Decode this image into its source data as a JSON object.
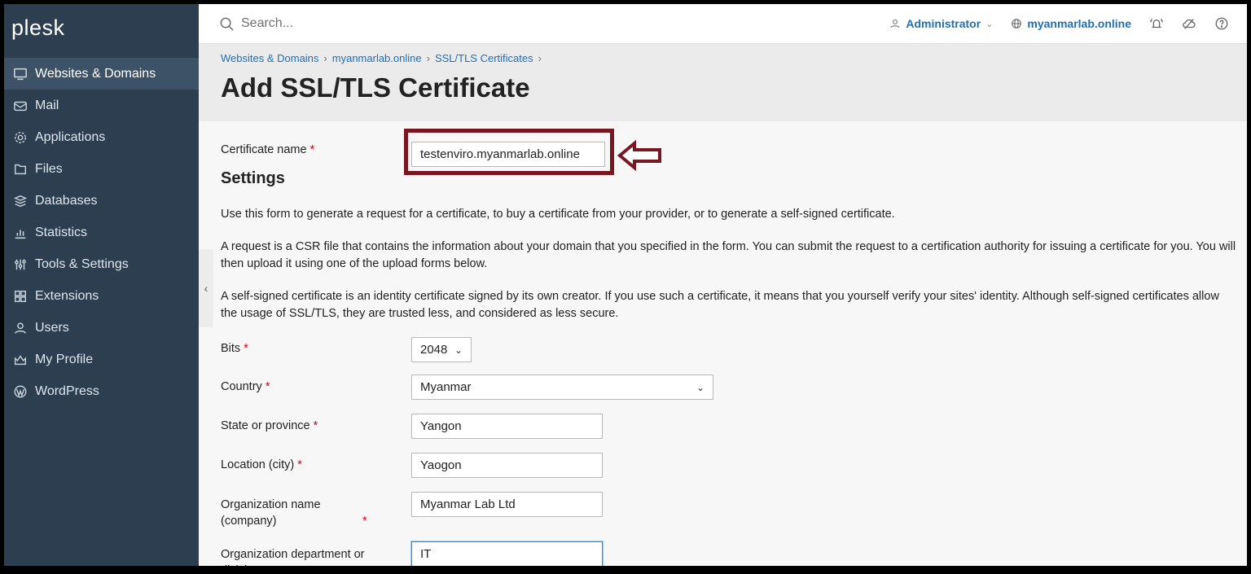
{
  "app": {
    "logo": "plesk"
  },
  "sidebar": {
    "items": [
      {
        "label": "Websites & Domains",
        "icon": "monitor-icon",
        "active": true
      },
      {
        "label": "Mail",
        "icon": "envelope-icon"
      },
      {
        "label": "Applications",
        "icon": "gear-icon"
      },
      {
        "label": "Files",
        "icon": "folder-icon"
      },
      {
        "label": "Databases",
        "icon": "database-icon"
      },
      {
        "label": "Statistics",
        "icon": "bar-chart-icon"
      },
      {
        "label": "Tools & Settings",
        "icon": "tools-icon"
      },
      {
        "label": "Extensions",
        "icon": "extensions-icon"
      },
      {
        "label": "Users",
        "icon": "user-icon"
      },
      {
        "label": "My Profile",
        "icon": "profile-icon"
      },
      {
        "label": "WordPress",
        "icon": "wordpress-icon"
      }
    ],
    "collapse_glyph": "‹"
  },
  "topbar": {
    "search_placeholder": "Search...",
    "user": "Administrator",
    "domain": "myanmarlab.online"
  },
  "breadcrumb": [
    "Websites & Domains",
    "myanmarlab.online",
    "SSL/TLS Certificates"
  ],
  "page_title": "Add SSL/TLS Certificate",
  "form": {
    "certificate_name": {
      "label": "Certificate name",
      "value": "testenviro.myanmarlab.online"
    },
    "settings_heading": "Settings",
    "paragraphs": [
      "Use this form to generate a request for a certificate, to buy a certificate from your provider, or to generate a self-signed certificate.",
      "A request is a CSR file that contains the information about your domain that you specified in the form. You can submit the request to a certification authority for issuing a certificate for you. You will then upload it using one of the upload forms below.",
      "A self-signed certificate is an identity certificate signed by its own creator. If you use such a certificate, it means that you yourself verify your sites' identity. Although self-signed certificates allow the usage of SSL/TLS, they are trusted less, and considered as less secure."
    ],
    "bits": {
      "label": "Bits",
      "value": "2048"
    },
    "country": {
      "label": "Country",
      "value": "Myanmar"
    },
    "state": {
      "label": "State or province",
      "value": "Yangon"
    },
    "city": {
      "label": "Location (city)",
      "value": "Yaogon"
    },
    "org": {
      "label": "Organization name (company)",
      "value": "Myanmar Lab Ltd"
    },
    "dept": {
      "label": "Organization department or division",
      "value": "IT"
    }
  },
  "colors": {
    "sidebar": "#2c3e50",
    "link": "#1f6fb3",
    "annotation": "#7a1621",
    "required": "#d0021b"
  }
}
